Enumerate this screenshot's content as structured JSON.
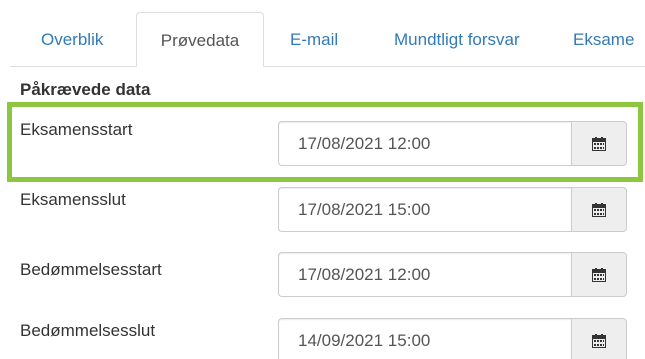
{
  "tabs": [
    {
      "label": "Overblik",
      "active": false
    },
    {
      "label": "Prøvedata",
      "active": true
    },
    {
      "label": "E-mail",
      "active": false
    },
    {
      "label": "Mundtligt forsvar",
      "active": false
    },
    {
      "label": "Eksame",
      "active": false
    }
  ],
  "section": {
    "title": "Påkrævede data"
  },
  "fields": [
    {
      "label": "Eksamensstart",
      "value": "17/08/2021 12:00",
      "icon": "calendar-icon",
      "highlighted": true
    },
    {
      "label": "Eksamensslut",
      "value": "17/08/2021 15:00",
      "icon": "calendar-icon",
      "highlighted": false
    },
    {
      "label": "Bedømmelsesstart",
      "value": "17/08/2021 12:00",
      "icon": "calendar-icon",
      "highlighted": false
    },
    {
      "label": "Bedømmelsesslut",
      "value": "14/09/2021 15:00",
      "icon": "calendar-icon",
      "highlighted": false
    }
  ],
  "colors": {
    "link": "#337ab7",
    "highlight": "#8dc63f",
    "text": "#333333"
  }
}
